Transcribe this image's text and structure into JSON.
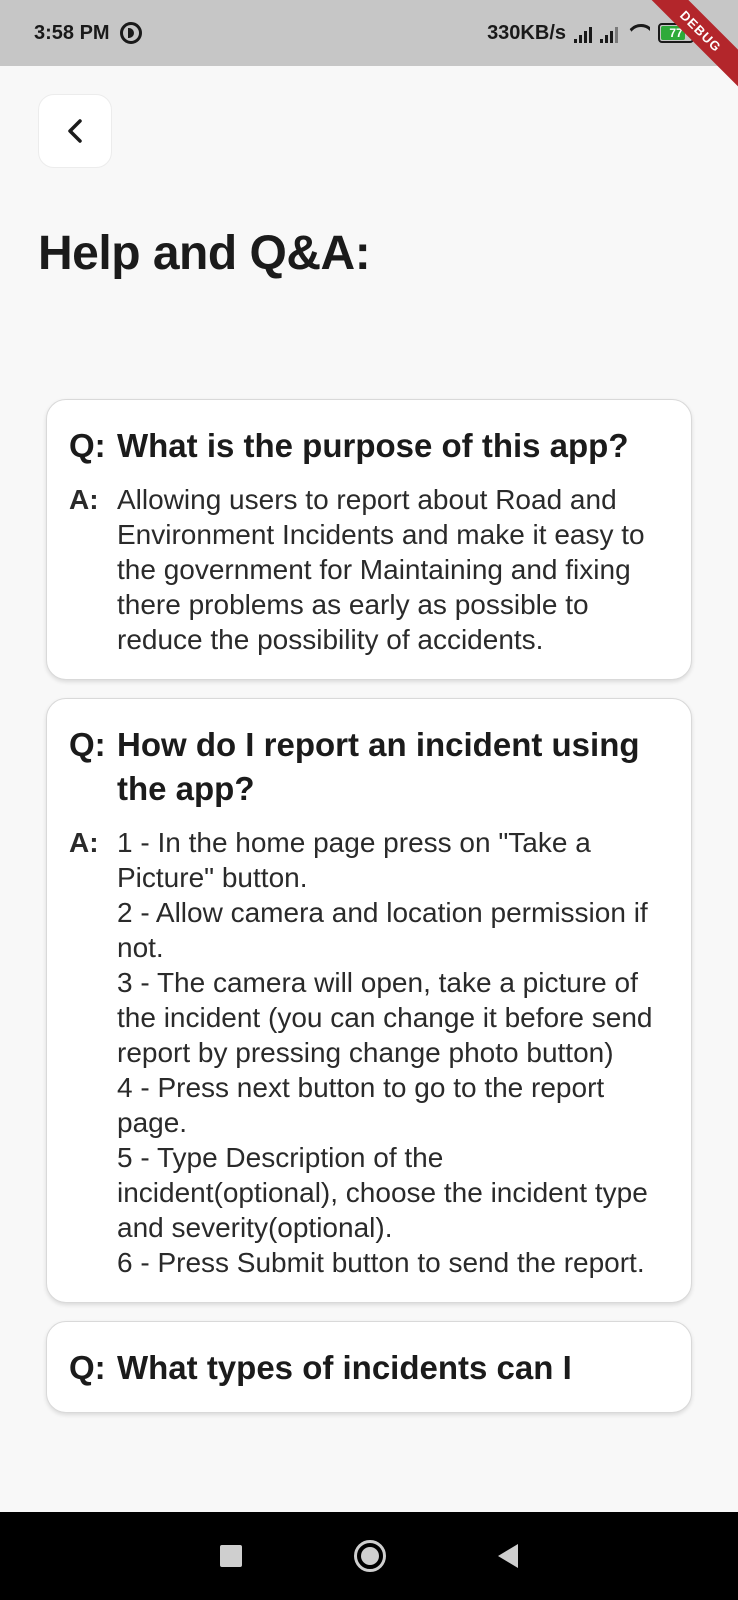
{
  "status_bar": {
    "time": "3:58 PM",
    "network_speed": "330KB/s",
    "battery_level": "77",
    "debug_banner": "DEBUG"
  },
  "header": {
    "back_icon": "chevron-left-icon",
    "title": "Help and Q&A:"
  },
  "faq": {
    "q_prefix": "Q:",
    "a_prefix": "A:",
    "items": [
      {
        "question": "What is the purpose of this app?",
        "answer": "Allowing users to report about Road and Environment Incidents and make it easy to the government for Maintaining and fixing there problems as early as possible to reduce the possibility of accidents."
      },
      {
        "question": "How do I report an incident using the app?",
        "answer": "1 - In the home page press on \"Take a Picture\" button.\n2 - Allow camera and location permission if not.\n3 - The camera will open, take a picture of the incident (you can change it before send report by pressing change photo button)\n4 - Press next button to go to the report page.\n5 - Type Description of the incident(optional), choose the incident type and severity(optional).\n6 - Press Submit button to send the report."
      },
      {
        "question": "What types of incidents can I",
        "answer": ""
      }
    ]
  },
  "nav_bar": {
    "recents_icon": "square-icon",
    "home_icon": "circle-icon",
    "back_icon": "triangle-back-icon"
  },
  "colors": {
    "status_bar_bg": "#c6c6c6",
    "page_bg": "#f8f8f8",
    "card_bg": "#ffffff",
    "debug_ribbon": "#b3262b"
  }
}
